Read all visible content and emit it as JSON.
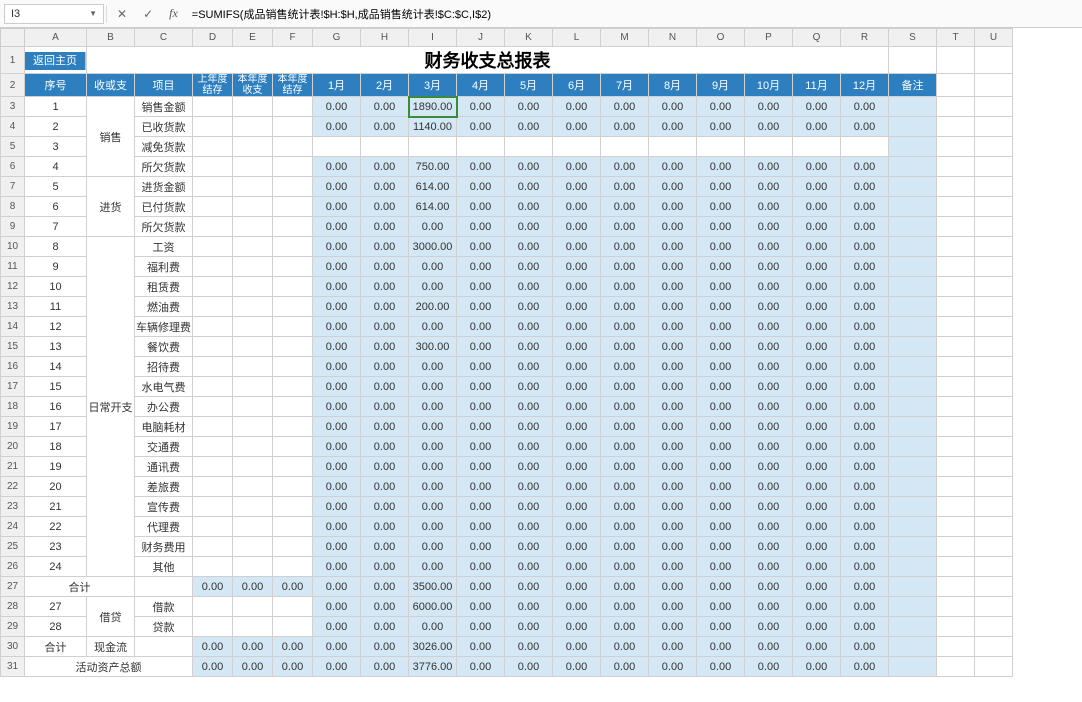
{
  "cellref": "I3",
  "formula": "=SUMIFS(成品销售统计表!$H:$H,成品销售统计表!$C:$C,I$2)",
  "cols": [
    "",
    "A",
    "B",
    "C",
    "D",
    "E",
    "F",
    "G",
    "H",
    "I",
    "J",
    "K",
    "L",
    "M",
    "N",
    "O",
    "P",
    "Q",
    "R",
    "S",
    "T",
    "U"
  ],
  "back": "返回主页",
  "title": "财务收支总报表",
  "hdr": {
    "no": "序号",
    "io": "收或支",
    "item": "项目",
    "ly": "上年度结存",
    "yi": "本年度收支",
    "ye": "本年度结存",
    "m": [
      "1月",
      "2月",
      "3月",
      "4月",
      "5月",
      "6月",
      "7月",
      "8月",
      "9月",
      "10月",
      "11月",
      "12月"
    ],
    "note": "备注"
  },
  "cats": {
    "c0": "销售",
    "c1": "进货",
    "c2": "日常开支",
    "c3": "借贷",
    "c4": "现金流",
    "sub": "合计",
    "act": "活动资产总额"
  },
  "items": [
    "销售金额",
    "已收货款",
    "减免货款",
    "所欠货款",
    "进货金额",
    "已付货款",
    "所欠货款",
    "工资",
    "福利费",
    "租赁费",
    "燃油费",
    "车辆修理费",
    "餐饮费",
    "招待费",
    "水电气费",
    "办公费",
    "电脑耗材",
    "交通费",
    "通讯费",
    "差旅费",
    "宣传费",
    "代理费",
    "财务费用",
    "其他",
    "借款",
    "贷款"
  ],
  "data": [
    [
      "0.00",
      "0.00",
      "1890.00",
      "0.00",
      "0.00",
      "0.00",
      "0.00",
      "0.00",
      "0.00",
      "0.00",
      "0.00",
      "0.00"
    ],
    [
      "0.00",
      "0.00",
      "1140.00",
      "0.00",
      "0.00",
      "0.00",
      "0.00",
      "0.00",
      "0.00",
      "0.00",
      "0.00",
      "0.00"
    ],
    null,
    [
      "0.00",
      "0.00",
      "750.00",
      "0.00",
      "0.00",
      "0.00",
      "0.00",
      "0.00",
      "0.00",
      "0.00",
      "0.00",
      "0.00"
    ],
    [
      "0.00",
      "0.00",
      "614.00",
      "0.00",
      "0.00",
      "0.00",
      "0.00",
      "0.00",
      "0.00",
      "0.00",
      "0.00",
      "0.00"
    ],
    [
      "0.00",
      "0.00",
      "614.00",
      "0.00",
      "0.00",
      "0.00",
      "0.00",
      "0.00",
      "0.00",
      "0.00",
      "0.00",
      "0.00"
    ],
    [
      "0.00",
      "0.00",
      "0.00",
      "0.00",
      "0.00",
      "0.00",
      "0.00",
      "0.00",
      "0.00",
      "0.00",
      "0.00",
      "0.00"
    ],
    [
      "0.00",
      "0.00",
      "3000.00",
      "0.00",
      "0.00",
      "0.00",
      "0.00",
      "0.00",
      "0.00",
      "0.00",
      "0.00",
      "0.00"
    ],
    [
      "0.00",
      "0.00",
      "0.00",
      "0.00",
      "0.00",
      "0.00",
      "0.00",
      "0.00",
      "0.00",
      "0.00",
      "0.00",
      "0.00"
    ],
    [
      "0.00",
      "0.00",
      "0.00",
      "0.00",
      "0.00",
      "0.00",
      "0.00",
      "0.00",
      "0.00",
      "0.00",
      "0.00",
      "0.00"
    ],
    [
      "0.00",
      "0.00",
      "200.00",
      "0.00",
      "0.00",
      "0.00",
      "0.00",
      "0.00",
      "0.00",
      "0.00",
      "0.00",
      "0.00"
    ],
    [
      "0.00",
      "0.00",
      "0.00",
      "0.00",
      "0.00",
      "0.00",
      "0.00",
      "0.00",
      "0.00",
      "0.00",
      "0.00",
      "0.00"
    ],
    [
      "0.00",
      "0.00",
      "300.00",
      "0.00",
      "0.00",
      "0.00",
      "0.00",
      "0.00",
      "0.00",
      "0.00",
      "0.00",
      "0.00"
    ],
    [
      "0.00",
      "0.00",
      "0.00",
      "0.00",
      "0.00",
      "0.00",
      "0.00",
      "0.00",
      "0.00",
      "0.00",
      "0.00",
      "0.00"
    ],
    [
      "0.00",
      "0.00",
      "0.00",
      "0.00",
      "0.00",
      "0.00",
      "0.00",
      "0.00",
      "0.00",
      "0.00",
      "0.00",
      "0.00"
    ],
    [
      "0.00",
      "0.00",
      "0.00",
      "0.00",
      "0.00",
      "0.00",
      "0.00",
      "0.00",
      "0.00",
      "0.00",
      "0.00",
      "0.00"
    ],
    [
      "0.00",
      "0.00",
      "0.00",
      "0.00",
      "0.00",
      "0.00",
      "0.00",
      "0.00",
      "0.00",
      "0.00",
      "0.00",
      "0.00"
    ],
    [
      "0.00",
      "0.00",
      "0.00",
      "0.00",
      "0.00",
      "0.00",
      "0.00",
      "0.00",
      "0.00",
      "0.00",
      "0.00",
      "0.00"
    ],
    [
      "0.00",
      "0.00",
      "0.00",
      "0.00",
      "0.00",
      "0.00",
      "0.00",
      "0.00",
      "0.00",
      "0.00",
      "0.00",
      "0.00"
    ],
    [
      "0.00",
      "0.00",
      "0.00",
      "0.00",
      "0.00",
      "0.00",
      "0.00",
      "0.00",
      "0.00",
      "0.00",
      "0.00",
      "0.00"
    ],
    [
      "0.00",
      "0.00",
      "0.00",
      "0.00",
      "0.00",
      "0.00",
      "0.00",
      "0.00",
      "0.00",
      "0.00",
      "0.00",
      "0.00"
    ],
    [
      "0.00",
      "0.00",
      "0.00",
      "0.00",
      "0.00",
      "0.00",
      "0.00",
      "0.00",
      "0.00",
      "0.00",
      "0.00",
      "0.00"
    ],
    [
      "0.00",
      "0.00",
      "0.00",
      "0.00",
      "0.00",
      "0.00",
      "0.00",
      "0.00",
      "0.00",
      "0.00",
      "0.00",
      "0.00"
    ],
    [
      "0.00",
      "0.00",
      "0.00",
      "0.00",
      "0.00",
      "0.00",
      "0.00",
      "0.00",
      "0.00",
      "0.00",
      "0.00",
      "0.00"
    ]
  ],
  "subtot1": [
    "0.00",
    "0.00",
    "0.00",
    "0.00",
    "0.00",
    "3500.00",
    "0.00",
    "0.00",
    "0.00",
    "0.00",
    "0.00",
    "0.00",
    "0.00",
    "0.00",
    "0.00"
  ],
  "loan": [
    [
      "0.00",
      "0.00",
      "6000.00",
      "0.00",
      "0.00",
      "0.00",
      "0.00",
      "0.00",
      "0.00",
      "0.00",
      "0.00",
      "0.00"
    ],
    [
      "0.00",
      "0.00",
      "0.00",
      "0.00",
      "0.00",
      "0.00",
      "0.00",
      "0.00",
      "0.00",
      "0.00",
      "0.00",
      "0.00"
    ]
  ],
  "cash": [
    "0.00",
    "0.00",
    "0.00",
    "0.00",
    "0.00",
    "3026.00",
    "0.00",
    "0.00",
    "0.00",
    "0.00",
    "0.00",
    "0.00",
    "0.00",
    "0.00",
    "0.00"
  ],
  "act": [
    "0.00",
    "0.00",
    "0.00",
    "0.00",
    "0.00",
    "3776.00",
    "0.00",
    "0.00",
    "0.00",
    "0.00",
    "0.00",
    "0.00",
    "0.00",
    "0.00",
    "0.00"
  ]
}
